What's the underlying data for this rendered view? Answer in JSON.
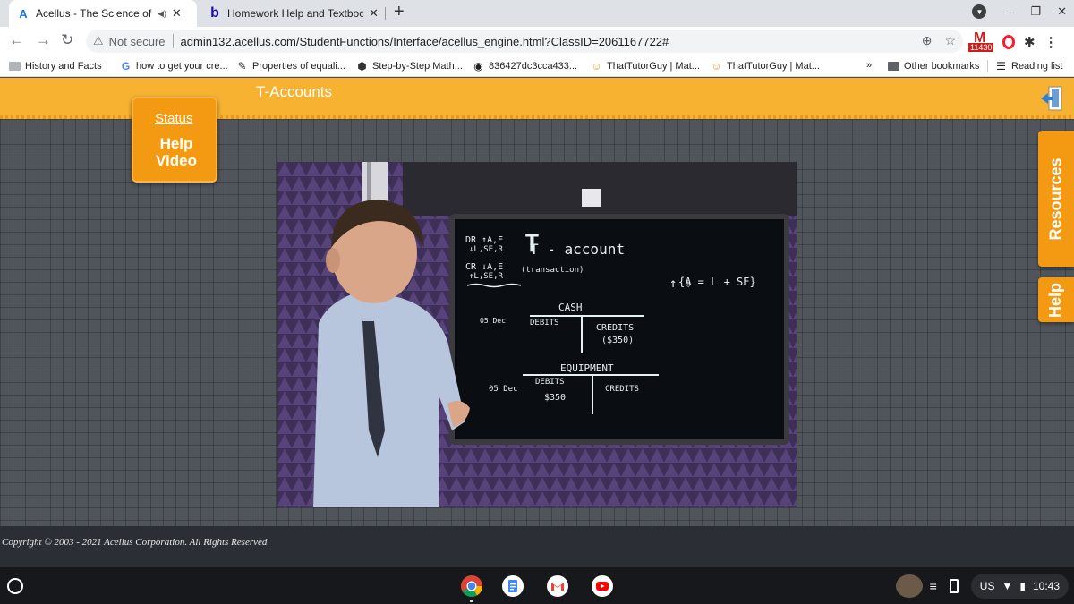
{
  "browser": {
    "tabs": [
      {
        "title": "Acellus - The Science of Lear",
        "favicon": "A",
        "audio": true,
        "active": true
      },
      {
        "title": "Homework Help and Textbook S",
        "favicon": "b",
        "active": false
      }
    ],
    "new_tab_label": "+",
    "url": {
      "security_text": "Not secure",
      "address": "admin132.acellus.com/StudentFunctions/Interface/acellus_engine.html?ClassID=2061167722#"
    },
    "extension_badge": "11430",
    "bookmarks": [
      {
        "label": "History and Facts",
        "icon": "folder-icon"
      },
      {
        "label": "how to get your cre...",
        "icon": "google-icon"
      },
      {
        "label": "Properties of equali...",
        "icon": "pencil-icon"
      },
      {
        "label": "Step-by-Step Math...",
        "icon": "step-icon"
      },
      {
        "label": "836427dc3cca433...",
        "icon": "chromium-icon"
      },
      {
        "label": "ThatTutorGuy | Mat...",
        "icon": "tutor-icon"
      },
      {
        "label": "ThatTutorGuy | Mat...",
        "icon": "tutor-icon"
      }
    ],
    "bookmarks_overflow": "»",
    "other_bookmarks": "Other bookmarks",
    "reading_list": "Reading list"
  },
  "app": {
    "page_title": "T-Accounts",
    "status_label": "Status",
    "help_video_label": "Help Video",
    "resources_label": "Resources",
    "help_label": "Help",
    "copyright": "Copyright © 2003 - 2021 Acellus Corporation. All Rights Reserved.",
    "colors": {
      "accent": "#f39a12",
      "header": "#f6b230",
      "workspace": "#50555b"
    }
  },
  "video": {
    "board": {
      "title": "T - account",
      "subtitle": "(transaction)",
      "dr_line": "DR ↑A,E",
      "dr_sub": "↓L,SE,R",
      "cr_line": "CR ↓A,E",
      "cr_sub": "↑L,SE,R",
      "equation": "{A = L + SE}",
      "cash_title": "CASH",
      "cash_date": "05 Dec",
      "cash_debits": "DEBITS",
      "cash_credits": "CREDITS",
      "cash_amount": "($350)",
      "equip_title": "EQUIPMENT",
      "equip_date": "05 Dec",
      "equip_debits": "DEBITS",
      "equip_credits": "CREDITS",
      "equip_amount": "$350"
    }
  },
  "shelf": {
    "apps": [
      "chrome-icon",
      "docs-icon",
      "gmail-icon",
      "youtube-icon"
    ],
    "locale": "US",
    "time": "10:43"
  }
}
